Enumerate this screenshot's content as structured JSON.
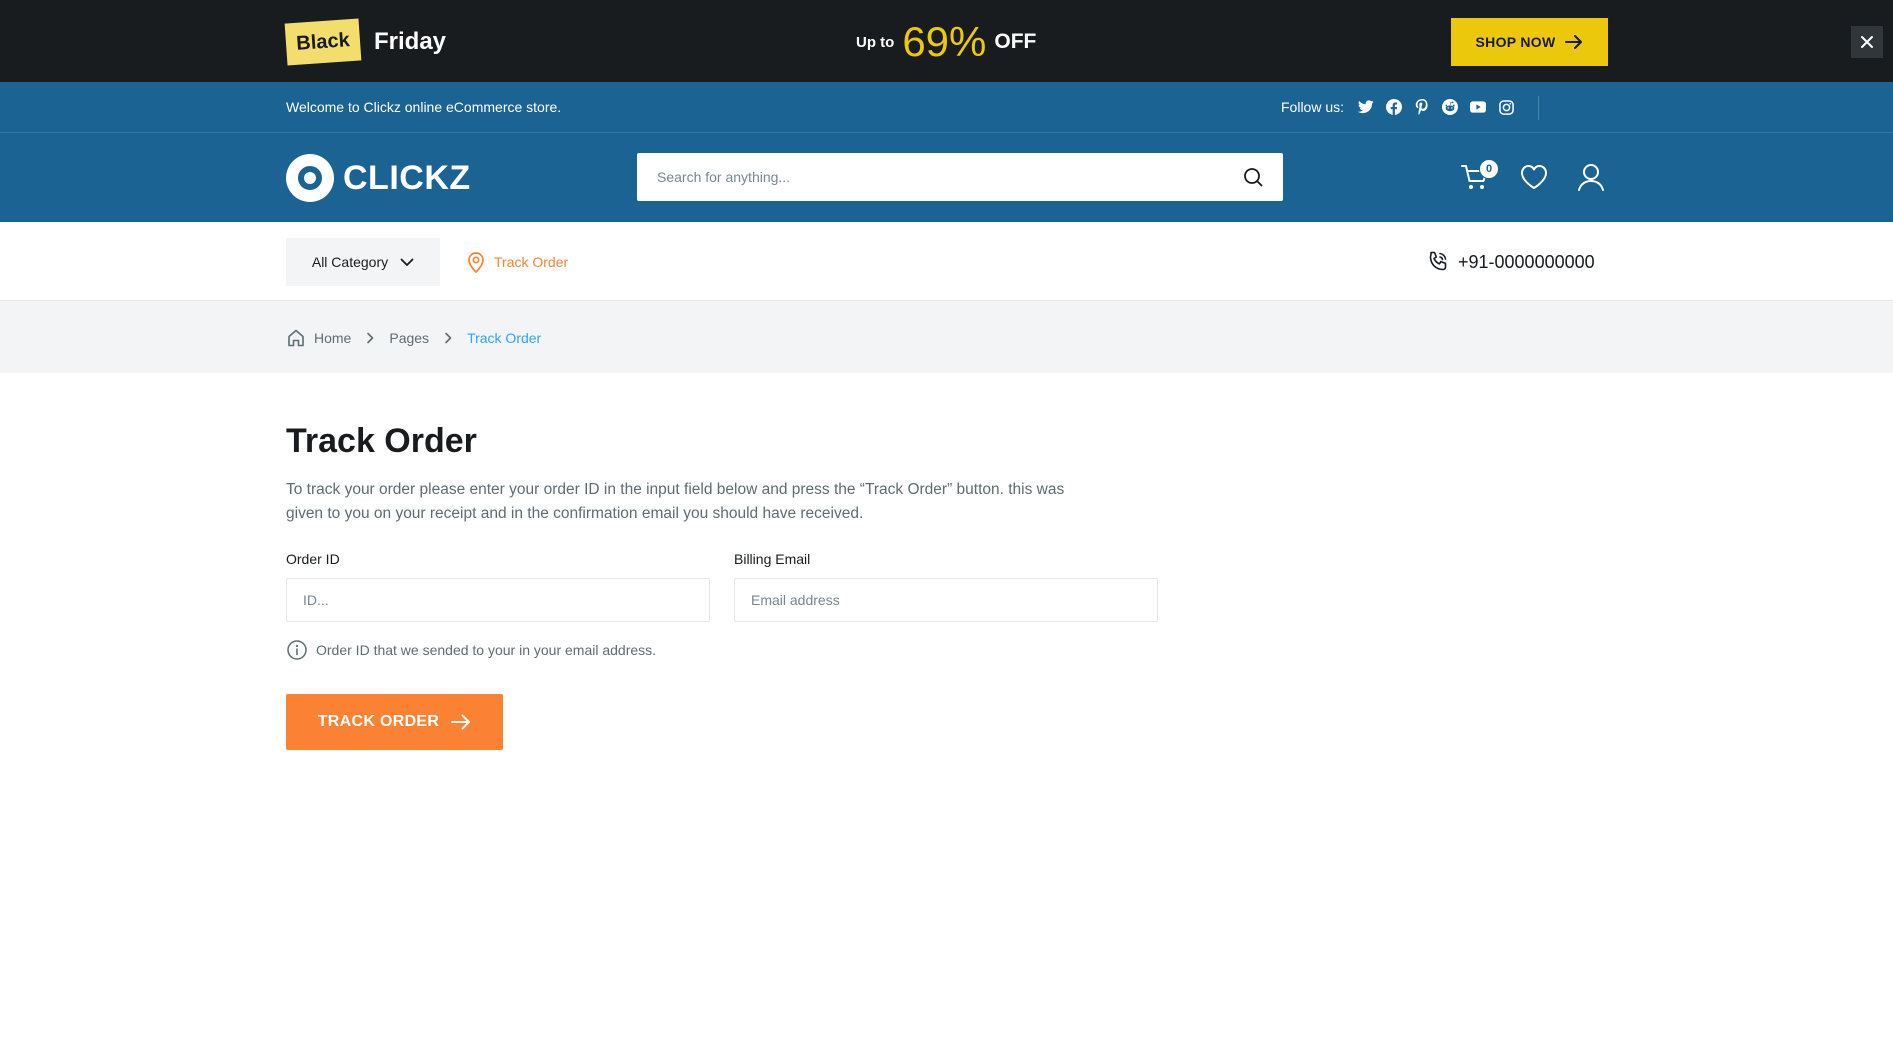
{
  "promo": {
    "badge": "Black",
    "title": "Friday",
    "up_to": "Up to",
    "percent": "69%",
    "off": "OFF",
    "shop_now": "SHOP NOW",
    "close_icon": "close-icon"
  },
  "topbar": {
    "welcome": "Welcome to Clickz online eCommerce store.",
    "follow_label": "Follow us:",
    "social": [
      "twitter-icon",
      "facebook-icon",
      "pinterest-icon",
      "reddit-icon",
      "youtube-icon",
      "instagram-icon"
    ]
  },
  "header": {
    "logo_text": "CLICKZ",
    "search_placeholder": "Search for anything...",
    "cart_count": "0"
  },
  "nav": {
    "all_category": "All Category",
    "track_order": "Track Order",
    "phone": "+91-0000000000"
  },
  "breadcrumb": {
    "home": "Home",
    "pages": "Pages",
    "current": "Track Order"
  },
  "main": {
    "title": "Track Order",
    "intro": "To track your order please enter your order ID in the input field below and press the “Track Order” button. this was given to you on your receipt and in the confirmation email you should have received.",
    "order_id_label": "Order ID",
    "order_id_placeholder": "ID...",
    "email_label": "Billing Email",
    "email_placeholder": "Email address",
    "hint": "Order ID that we sended to your in your email address.",
    "button": "TRACK ORDER"
  },
  "colors": {
    "promo_bg": "#191c1f",
    "accent_yellow": "#ebc80c",
    "brand_blue": "#1b6392",
    "accent_orange": "#fa8232",
    "link_blue": "#2da5f3"
  }
}
